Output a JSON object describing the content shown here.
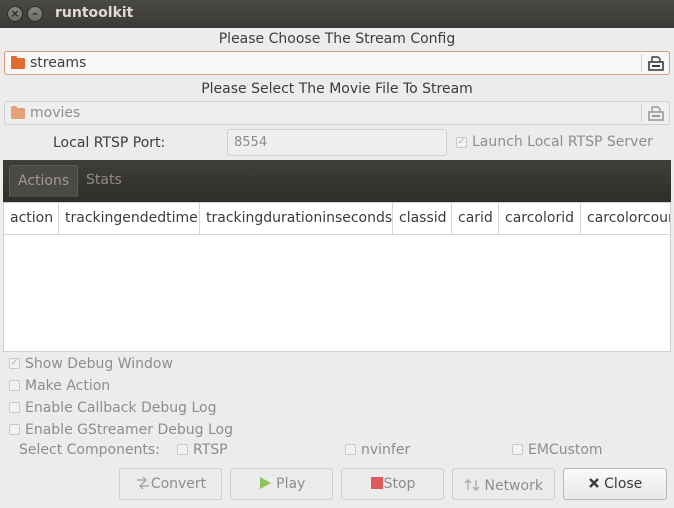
{
  "window": {
    "title": "runtoolkit"
  },
  "stream_config": {
    "label": "Please Choose The Stream Config",
    "value": "streams"
  },
  "movie_file": {
    "label": "Please Select The Movie File To Stream",
    "value": "movies"
  },
  "rtsp": {
    "port_label": "Local RTSP Port:",
    "port_value": "8554",
    "launch_label": "Launch Local RTSP Server",
    "launch_checked": true
  },
  "tabs": [
    {
      "label": "Actions",
      "active": true
    },
    {
      "label": "Stats",
      "active": false
    }
  ],
  "table": {
    "columns": [
      "action",
      "trackingendedtime",
      "trackingdurationinseconds",
      "classid",
      "carid",
      "carcolorid",
      "carcolorcour"
    ],
    "rows": []
  },
  "options": {
    "show_debug_window": {
      "label": "Show Debug Window",
      "checked": true
    },
    "make_action": {
      "label": "Make Action",
      "checked": false
    },
    "callback_debug": {
      "label": "Enable Callback Debug Log",
      "checked": false
    },
    "gstreamer_debug": {
      "label": "Enable GStreamer Debug Log",
      "checked": false
    }
  },
  "components": {
    "label": "Select Components:",
    "rtsp": "RTSP",
    "nvinfer": "nvinfer",
    "emcustom": "EMCustom"
  },
  "buttons": {
    "convert": "Convert",
    "play": "Play",
    "stop": "Stop",
    "network": "Network",
    "close": "Close"
  },
  "icons": {
    "folder": "folder-icon",
    "file_open": "document-open-icon",
    "convert": "convert-icon",
    "play": "play-icon",
    "stop": "stop-icon",
    "network": "network-icon",
    "close": "close-x-icon"
  },
  "colors": {
    "folder": "#e06d2f",
    "play": "#8fc35a",
    "stop": "#e05a5a",
    "titlebar": "#3b3a36"
  }
}
